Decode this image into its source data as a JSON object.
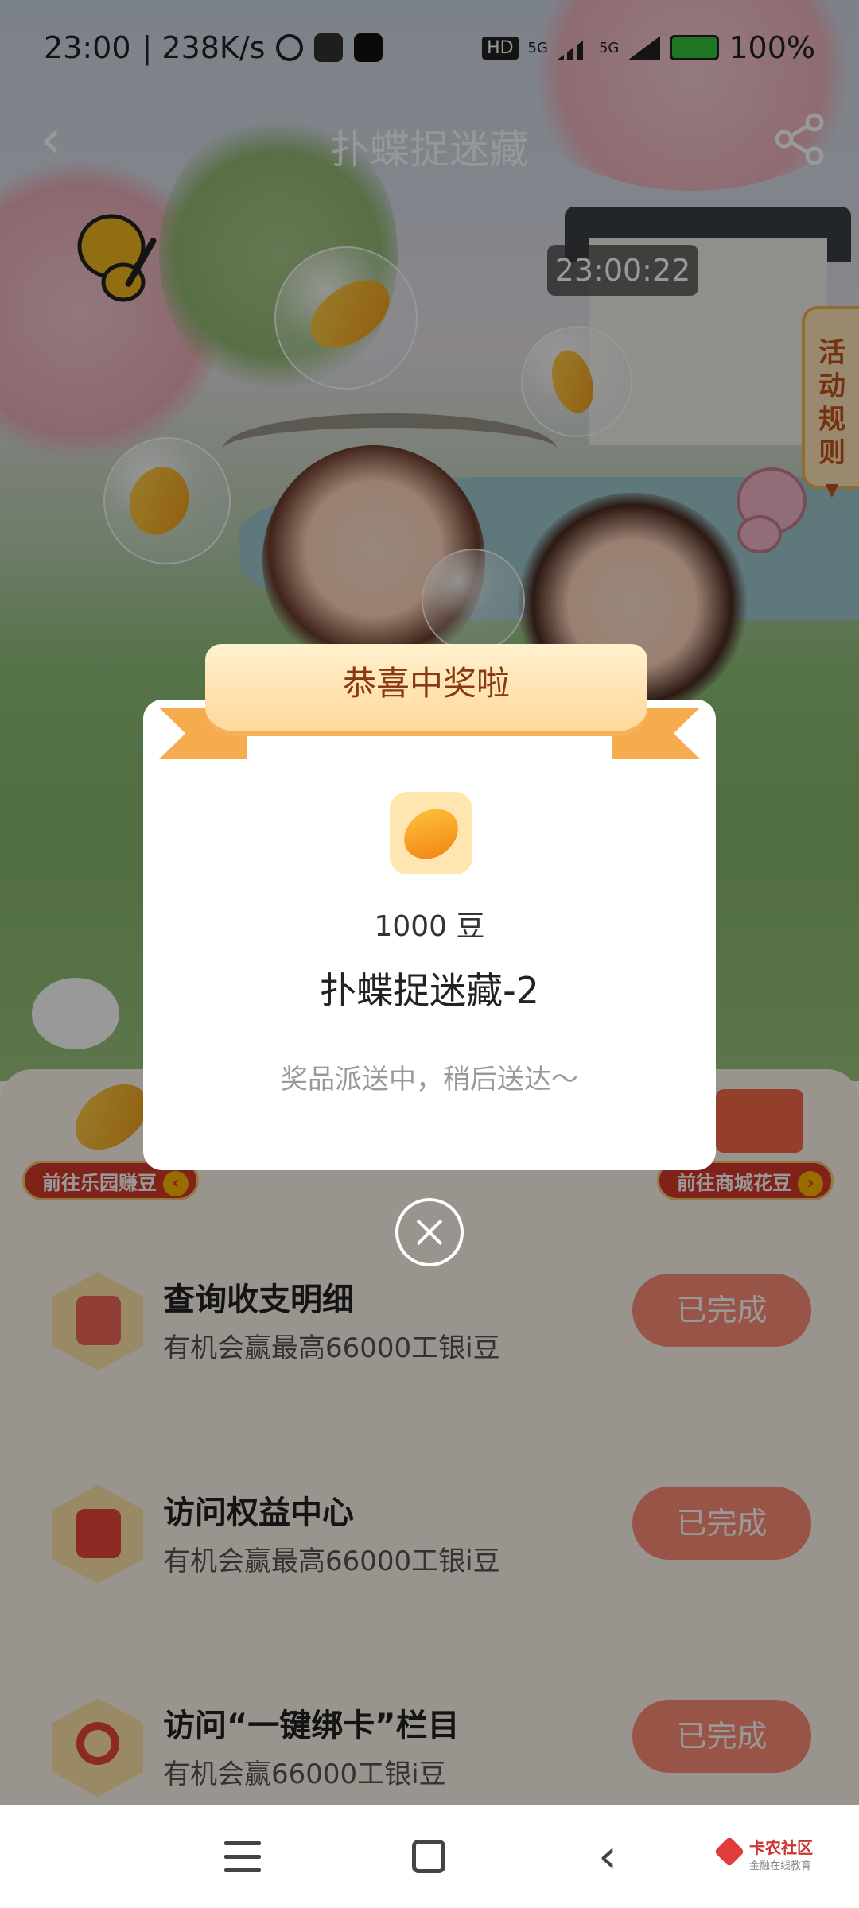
{
  "status_bar": {
    "time": "23:00",
    "net_speed": "| 238K/s",
    "signal_1": "5G",
    "signal_2": "5G",
    "hd": "HD",
    "battery": "100%"
  },
  "header": {
    "title": "扑蝶捉迷藏"
  },
  "clock_badge": "23:00:22",
  "rules_tab": "活动规则",
  "promo": {
    "left_label": "前往乐园赚豆",
    "right_label": "前往商城花豆"
  },
  "tasks": [
    {
      "title": "查询收支明细",
      "subtitle": "有机会赢最高66000工银i豆",
      "button": "已完成"
    },
    {
      "title": "访问权益中心",
      "subtitle": "有机会赢最高66000工银i豆",
      "button": "已完成"
    },
    {
      "title": "访问“一键绑卡”栏目",
      "subtitle": "有机会赢66000工银i豆",
      "button": "已完成"
    }
  ],
  "modal": {
    "ribbon_title": "恭喜中奖啦",
    "amount": "1000 豆",
    "prize_name": "扑蝶捉迷藏-2",
    "status": "奖品派送中，稍后送达～"
  },
  "watermark": {
    "title": "卡农社区",
    "subtitle": "金融在线教育"
  },
  "colors": {
    "accent": "#ff8c78",
    "ribbon_text": "#8a3a13",
    "pill_red": "#d83a2c"
  },
  "icons": [
    "back-icon",
    "share-icon",
    "close-icon",
    "menu-icon",
    "home-icon",
    "nav-back-icon",
    "alarm-icon",
    "battery-icon"
  ]
}
